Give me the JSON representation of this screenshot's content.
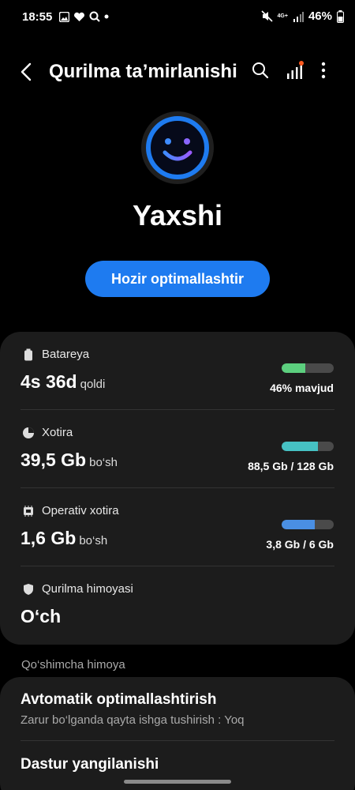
{
  "status_bar": {
    "time": "18:55",
    "network": "4G+",
    "battery_percent": "46%"
  },
  "header": {
    "title": "Qurilma ta’mirlanishi",
    "back_icon": "back-arrow-icon",
    "search_icon": "search-icon",
    "signal_icon": "signal-bars-icon",
    "more_icon": "more-vert-icon"
  },
  "hero": {
    "state": "Yaxshi",
    "face_icon": "smile-icon",
    "accent": "#1e7bf0",
    "button_label": "Hozir optimallashtir"
  },
  "stats": [
    {
      "label": "Batareya",
      "icon": "battery-icon",
      "value": "4s 36d",
      "unit": "qoldi",
      "detail": "46% mavjud",
      "fill_fraction": 0.46,
      "color": "#5ccf7e"
    },
    {
      "label": "Xotira",
      "icon": "pie-chart-icon",
      "value": "39,5 Gb",
      "unit": "bo‘sh",
      "detail": "88,5 Gb / 128 Gb",
      "fill_fraction": 0.69,
      "color": "#46c1c3"
    },
    {
      "label": "Operativ xotira",
      "icon": "memory-chip-icon",
      "value": "1,6 Gb",
      "unit": "bo‘sh",
      "detail": "3,8 Gb / 6 Gb",
      "fill_fraction": 0.63,
      "color": "#4a8fe3"
    },
    {
      "label": "Qurilma himoyasi",
      "icon": "shield-icon",
      "value": "O‘ch"
    }
  ],
  "extra": {
    "section_title": "Qo‘shimcha himoya",
    "auto_title": "Avtomatik optimallashtirish",
    "auto_subtitle": "Zarur bo‘lganda qayta ishga tushirish : Yoq",
    "update_title": "Dastur yangilanishi"
  }
}
